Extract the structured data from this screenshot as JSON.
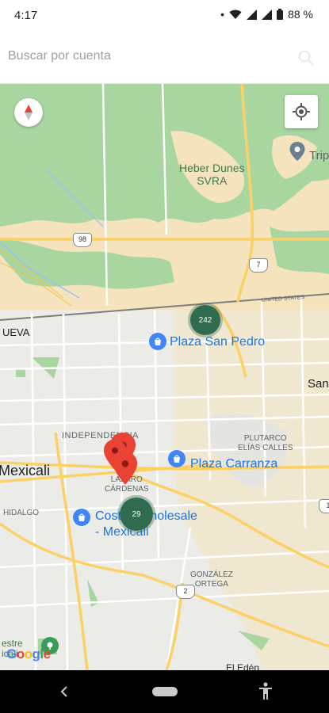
{
  "status_bar": {
    "time": "4:17",
    "dot": "•",
    "battery": "88 %"
  },
  "search": {
    "placeholder": "Buscar por cuenta",
    "value": ""
  },
  "map": {
    "labels": {
      "park": "Heber Dunes\nSVRA",
      "triple": "Tripl",
      "city": "Mexicali",
      "nueva": "UEVA",
      "san": "San",
      "independencia": "INDEPENDENCIA",
      "lazaro": "LÁZARO\nCÁRDENAS",
      "plutarco": "PLUTARCO\nELÍAS CALLES",
      "hidalgo": "HIDALGO",
      "gonzalez": "GONZÁLEZ\nORTEGA",
      "united_states": "UNITED STATES",
      "eleden": "El Edén",
      "estre": "estre\nicali"
    },
    "places": {
      "plaza_san_pedro": "Plaza San Pedro",
      "plaza_carranza": "Plaza Carranza",
      "costco": "Costco Wholesale\n- Mexicali"
    },
    "routes": {
      "r98": "98",
      "r7": "7",
      "r2": "2",
      "r1": "1"
    },
    "clusters": {
      "c1": "242",
      "c2": "29"
    },
    "google_logo": "Google",
    "colors": {
      "park": "#a8d5a0",
      "sand": "#f4e3bd",
      "road": "#fbd165",
      "street": "#ffffff",
      "cluster": "#2e6b4f",
      "pin": "#ea4335",
      "place": "#1a73e8"
    }
  }
}
